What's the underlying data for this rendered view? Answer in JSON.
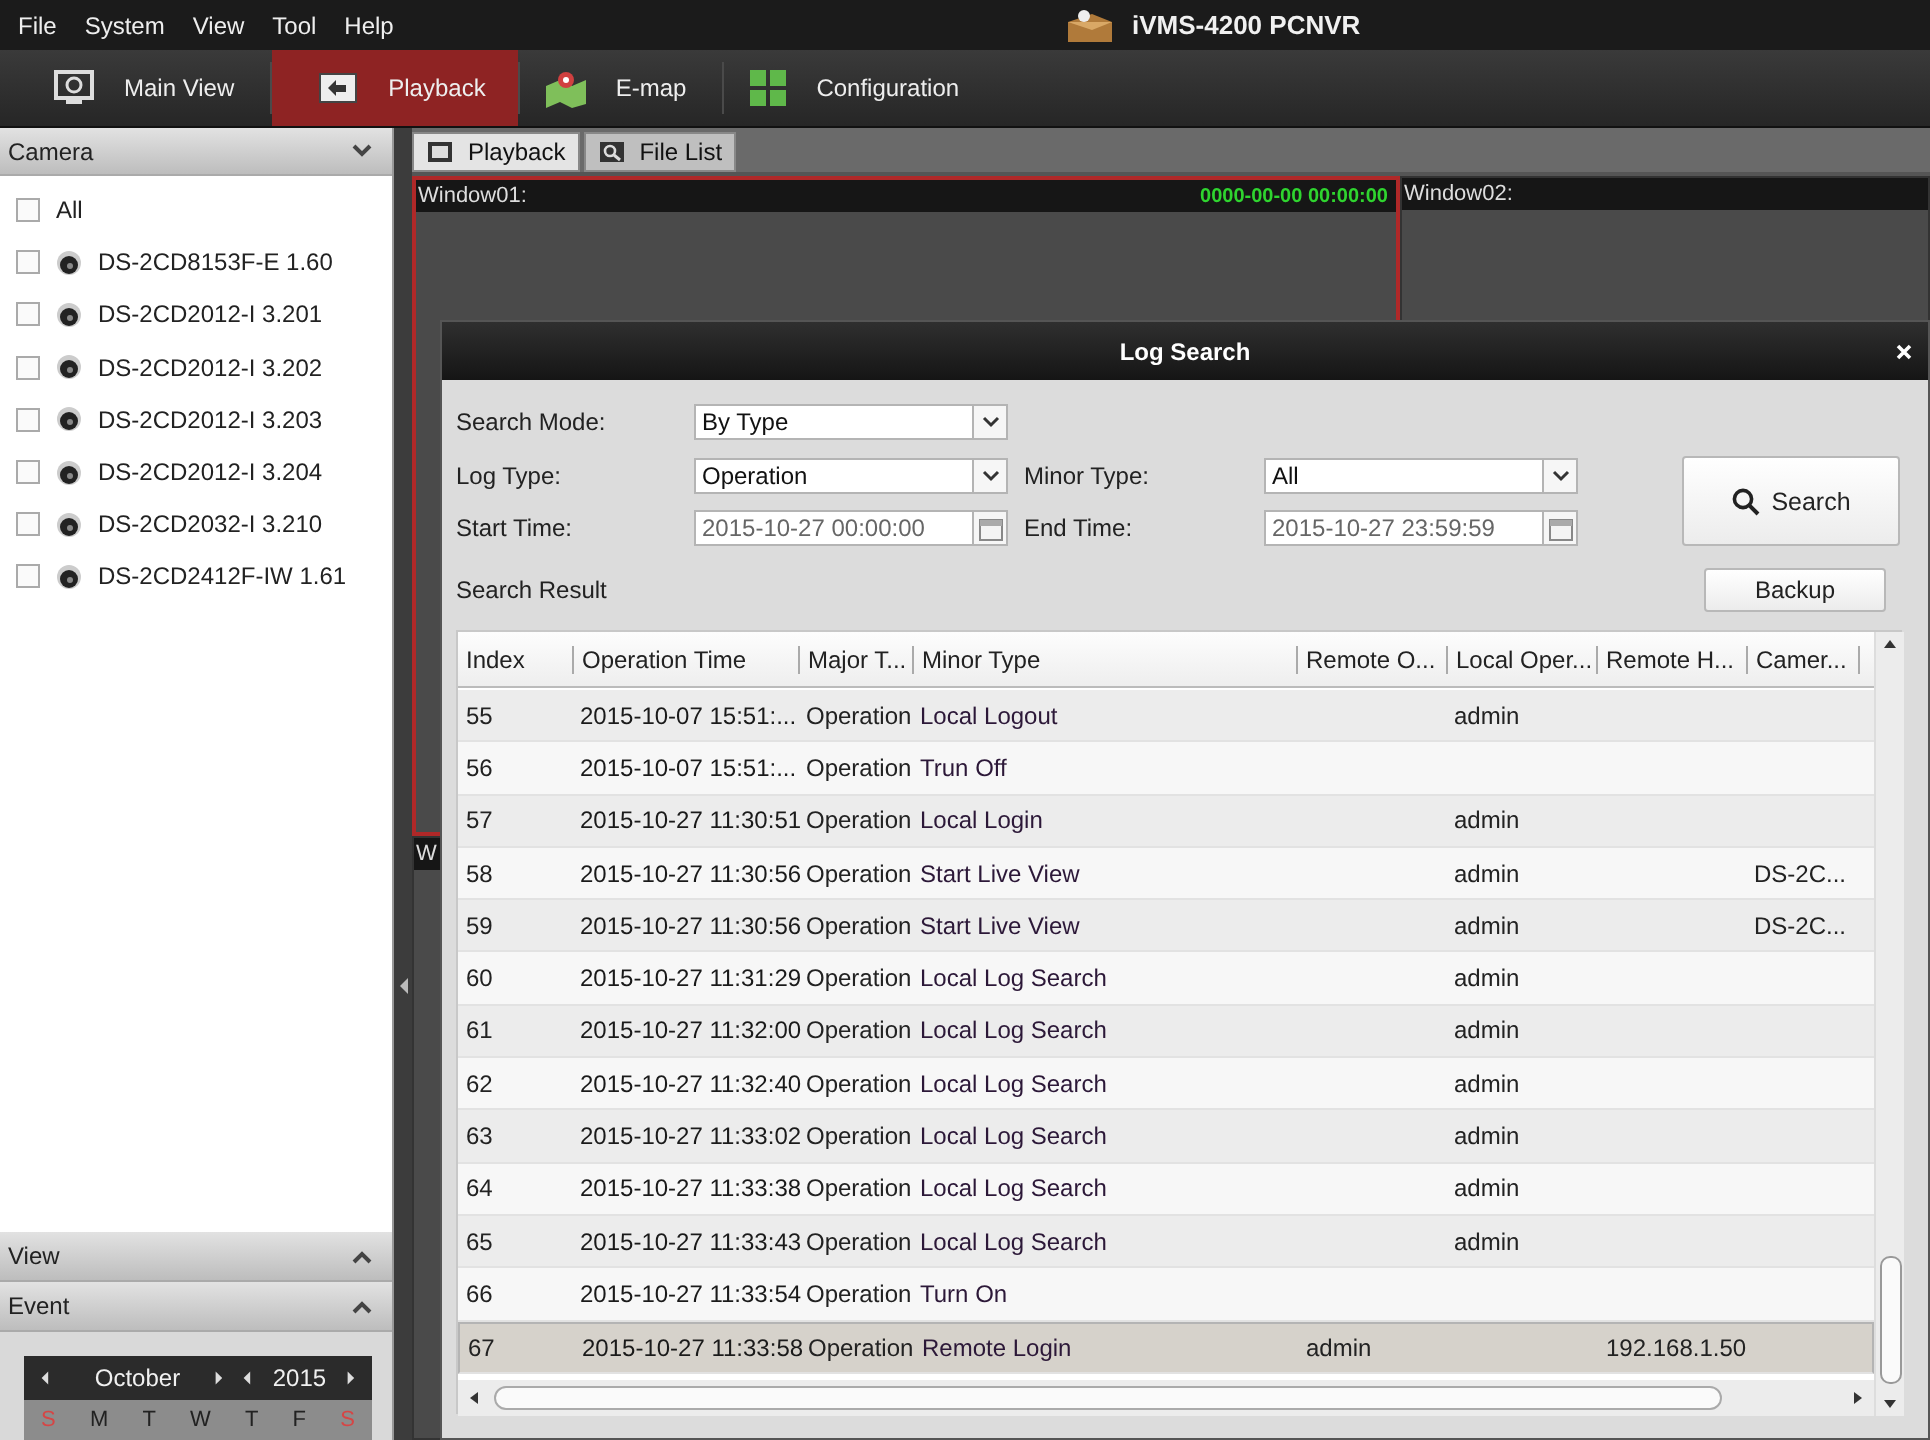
{
  "menu": [
    "File",
    "System",
    "View",
    "Tool",
    "Help"
  ],
  "app_title": "iVMS-4200  PCNVR",
  "toolbar": [
    {
      "label": "Main View",
      "selected": false,
      "kind": "monitor"
    },
    {
      "label": "Playback",
      "selected": true,
      "kind": "playback"
    },
    {
      "label": "E-map",
      "selected": false,
      "kind": "map"
    },
    {
      "label": "Configuration",
      "selected": false,
      "kind": "grid"
    }
  ],
  "sidebar": {
    "camera_header": {
      "label": "Camera",
      "expanded": true
    },
    "all": {
      "label": "All",
      "checked": false
    },
    "cameras": [
      {
        "name": "DS-2CD8153F-E 1.60",
        "checked": false
      },
      {
        "name": "DS-2CD2012-I 3.201",
        "checked": false
      },
      {
        "name": "DS-2CD2012-I 3.202",
        "checked": false
      },
      {
        "name": "DS-2CD2012-I 3.203",
        "checked": false
      },
      {
        "name": "DS-2CD2012-I 3.204",
        "checked": false
      },
      {
        "name": "DS-2CD2032-I 3.210",
        "checked": false
      },
      {
        "name": "DS-2CD2412F-IW 1.61",
        "checked": false
      }
    ],
    "sections": [
      {
        "label": "View",
        "expanded": false
      },
      {
        "label": "Event",
        "expanded": false
      }
    ],
    "calendar": {
      "month": "October",
      "year": "2015",
      "weekdays": [
        {
          "label": "S",
          "weekend": true
        },
        {
          "label": "M",
          "weekend": false
        },
        {
          "label": "T",
          "weekend": false
        },
        {
          "label": "W",
          "weekend": false
        },
        {
          "label": "T",
          "weekend": false
        },
        {
          "label": "F",
          "weekend": false
        },
        {
          "label": "S",
          "weekend": true
        }
      ]
    }
  },
  "content_tabs": [
    {
      "label": "Playback",
      "selected": true
    },
    {
      "label": "File List",
      "selected": false
    }
  ],
  "windows": [
    {
      "title": "Window01:",
      "time": "0000-00-00 00:00:00",
      "selected": true
    },
    {
      "title": "Window02:",
      "selected": false
    },
    {
      "title": "W",
      "selected": false
    }
  ],
  "dialog": {
    "title": "Log Search",
    "search_mode": {
      "label": "Search Mode:",
      "value": "By Type"
    },
    "log_type": {
      "label": "Log Type:",
      "value": "Operation"
    },
    "minor_type": {
      "label": "Minor Type:",
      "value": "All"
    },
    "start_time": {
      "label": "Start Time:",
      "value": "2015-10-27 00:00:00"
    },
    "end_time": {
      "label": "End Time:",
      "value": "2015-10-27 23:59:59"
    },
    "search_button": "Search",
    "result_label": "Search Result",
    "backup_button": "Backup",
    "table": {
      "columns": [
        "Index",
        "Operation Time",
        "Major T...",
        "Minor Type",
        "Remote O...",
        "Local Oper...",
        "Remote H...",
        "Camer..."
      ],
      "rows": [
        {
          "index": "55",
          "operation_time": "2015-10-07 15:51:...",
          "major_type": "Operation",
          "minor_type": "Local Logout",
          "local_operator": "admin",
          "selected": false
        },
        {
          "index": "56",
          "operation_time": "2015-10-07 15:51:...",
          "major_type": "Operation",
          "minor_type": "Trun Off",
          "selected": false
        },
        {
          "index": "57",
          "operation_time": "2015-10-27 11:30:51",
          "major_type": "Operation",
          "minor_type": "Local Login",
          "local_operator": "admin",
          "selected": false
        },
        {
          "index": "58",
          "operation_time": "2015-10-27 11:30:56",
          "major_type": "Operation",
          "minor_type": "Start Live View",
          "local_operator": "admin",
          "camera": "DS-2C...",
          "selected": false
        },
        {
          "index": "59",
          "operation_time": "2015-10-27 11:30:56",
          "major_type": "Operation",
          "minor_type": "Start Live View",
          "local_operator": "admin",
          "camera": "DS-2C...",
          "selected": false
        },
        {
          "index": "60",
          "operation_time": "2015-10-27 11:31:29",
          "major_type": "Operation",
          "minor_type": "Local Log Search",
          "local_operator": "admin",
          "selected": false
        },
        {
          "index": "61",
          "operation_time": "2015-10-27 11:32:00",
          "major_type": "Operation",
          "minor_type": "Local Log Search",
          "local_operator": "admin",
          "selected": false
        },
        {
          "index": "62",
          "operation_time": "2015-10-27 11:32:40",
          "major_type": "Operation",
          "minor_type": "Local Log Search",
          "local_operator": "admin",
          "selected": false
        },
        {
          "index": "63",
          "operation_time": "2015-10-27 11:33:02",
          "major_type": "Operation",
          "minor_type": "Local Log Search",
          "local_operator": "admin",
          "selected": false
        },
        {
          "index": "64",
          "operation_time": "2015-10-27 11:33:38",
          "major_type": "Operation",
          "minor_type": "Local Log Search",
          "local_operator": "admin",
          "selected": false
        },
        {
          "index": "65",
          "operation_time": "2015-10-27 11:33:43",
          "major_type": "Operation",
          "minor_type": "Local Log Search",
          "local_operator": "admin",
          "selected": false
        },
        {
          "index": "66",
          "operation_time": "2015-10-27 11:33:54",
          "major_type": "Operation",
          "minor_type": "Turn On",
          "selected": false
        },
        {
          "index": "67",
          "operation_time": "2015-10-27 11:33:58",
          "major_type": "Operation",
          "minor_type": "Remote Login",
          "remote_operator": "admin",
          "remote_host": "192.168.1.50",
          "selected": true
        }
      ]
    }
  }
}
